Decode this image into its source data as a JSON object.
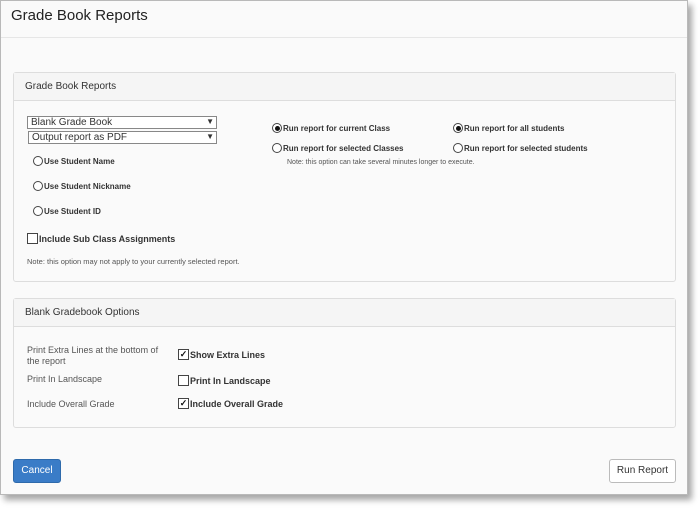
{
  "dialog": {
    "title": "Grade Book Reports"
  },
  "report_panel": {
    "heading": "Grade Book Reports",
    "report_select": "Blank Grade Book",
    "output_select": "Output report as PDF",
    "name_options": [
      "Use Student Name",
      "Use Student Nickname",
      "Use Student ID"
    ],
    "class_options": [
      "Run report for current Class",
      "Run report for selected Classes"
    ],
    "class_note": "Note: this option can take several minutes longer to execute.",
    "student_options": [
      "Run report for all students",
      "Run report for selected students"
    ],
    "sub_class_label": "Include Sub Class Assignments",
    "sub_class_note": "Note: this option may not apply to your currently selected report."
  },
  "options_panel": {
    "heading": "Blank Gradebook Options",
    "rows": [
      {
        "label": "Print Extra Lines at the bottom of the report",
        "option": "Show Extra Lines",
        "checked": true
      },
      {
        "label": "Print In Landscape",
        "option": "Print In Landscape",
        "checked": false
      },
      {
        "label": "Include Overall Grade",
        "option": "Include Overall Grade",
        "checked": true
      }
    ]
  },
  "footer": {
    "cancel_label": "Cancel",
    "run_label": "Run Report"
  }
}
